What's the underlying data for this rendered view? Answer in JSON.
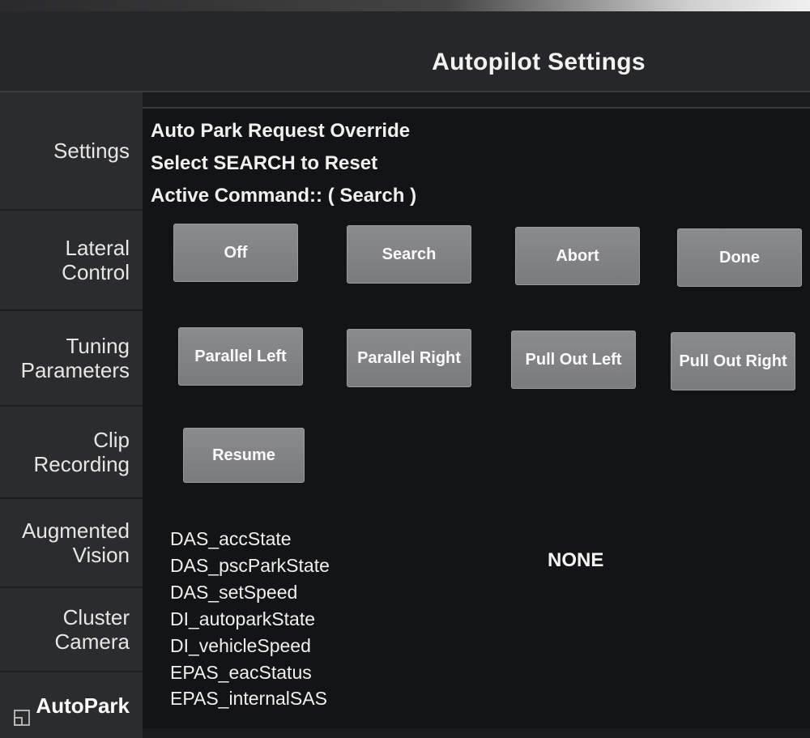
{
  "header": {
    "title": "Autopilot Settings"
  },
  "sidebar": {
    "items": [
      {
        "label": "Settings"
      },
      {
        "label": "Lateral\nControl"
      },
      {
        "label": "Tuning\nParameters"
      },
      {
        "label": "Clip\nRecording"
      },
      {
        "label": "Augmented\nVision"
      },
      {
        "label": "Cluster\nCamera"
      },
      {
        "label": "AutoPark"
      }
    ],
    "active": "AutoPark"
  },
  "main": {
    "info": {
      "line1": "Auto Park Request Override",
      "line2": "Select SEARCH to Reset",
      "line3": "Active Command:: ( Search )"
    },
    "buttons": {
      "off": "Off",
      "search": "Search",
      "abort": "Abort",
      "done": "Done",
      "parallel_left": "Parallel Left",
      "parallel_right": "Parallel Right",
      "pull_out_left": "Pull Out Left",
      "pull_out_right": "Pull Out Right",
      "resume": "Resume"
    },
    "signals": [
      "DAS_accState",
      "DAS_pscParkState",
      "DAS_setSpeed",
      "DI_autoparkState",
      "DI_vehicleSpeed",
      "EPAS_eacStatus",
      "EPAS_internalSAS"
    ],
    "signal_value": "NONE"
  },
  "colors": {
    "background": "#131416",
    "sidebar": "#2b2c2e",
    "button": "#808184"
  }
}
